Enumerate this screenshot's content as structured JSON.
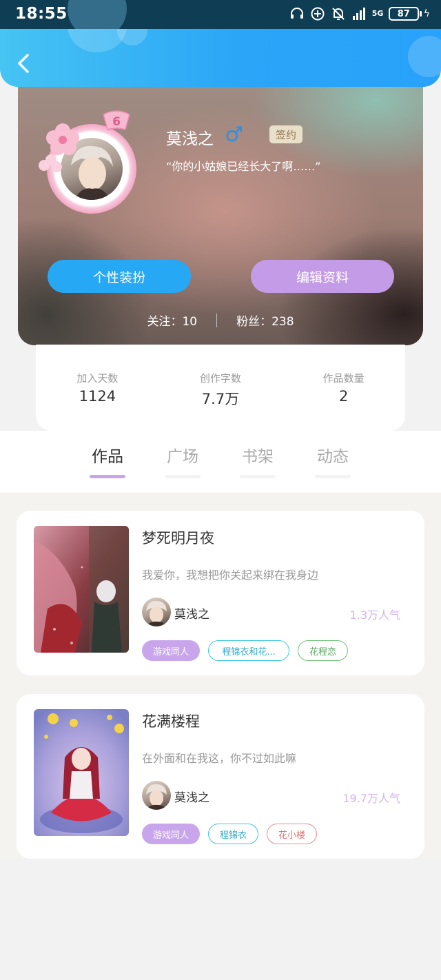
{
  "status_bar": {
    "time": "18:55",
    "icons": [
      "headset-icon",
      "add-circle-icon",
      "bell-off-icon",
      "signal-icon",
      "5g-icon"
    ],
    "network": "5G",
    "battery": "87"
  },
  "header": {
    "back_icon": "chevron-left-icon"
  },
  "profile": {
    "name": "莫浅之",
    "gender_symbol": "♂",
    "sign_badge": "签约",
    "quote": "“你的小姑娘已经长大了啊……”",
    "level": "6",
    "dress_button": "个性装扮",
    "edit_button": "编辑资料",
    "following_label": "关注：",
    "following_count": "10",
    "fans_label": "粉丝：",
    "fans_count": "238"
  },
  "stats": [
    {
      "label": "加入天数",
      "value": "1124"
    },
    {
      "label": "创作字数",
      "value": "7.7万"
    },
    {
      "label": "作品数量",
      "value": "2"
    }
  ],
  "tabs": [
    {
      "label": "作品",
      "active": true
    },
    {
      "label": "广场",
      "active": false
    },
    {
      "label": "书架",
      "active": false
    },
    {
      "label": "动态",
      "active": false
    }
  ],
  "works": [
    {
      "title": "梦死明月夜",
      "desc": "我爱你，我想把你关起来绑在我身边",
      "author": "莫浅之",
      "popularity": "1.3万人气",
      "tags": [
        "游戏同人",
        "程锦衣和花...",
        "花程恋"
      ]
    },
    {
      "title": "花满楼程",
      "desc": "在外面和在我这，你不过如此嘛",
      "author": "莫浅之",
      "popularity": "19.7万人气",
      "tags": [
        "游戏同人",
        "程锦衣",
        "花小楼"
      ]
    }
  ],
  "colors": {
    "header_blue": "#2aa5f7",
    "accent_purple": "#c39be6",
    "button_blue": "#27a8f4",
    "gender_blue": "#2f8fe0"
  }
}
